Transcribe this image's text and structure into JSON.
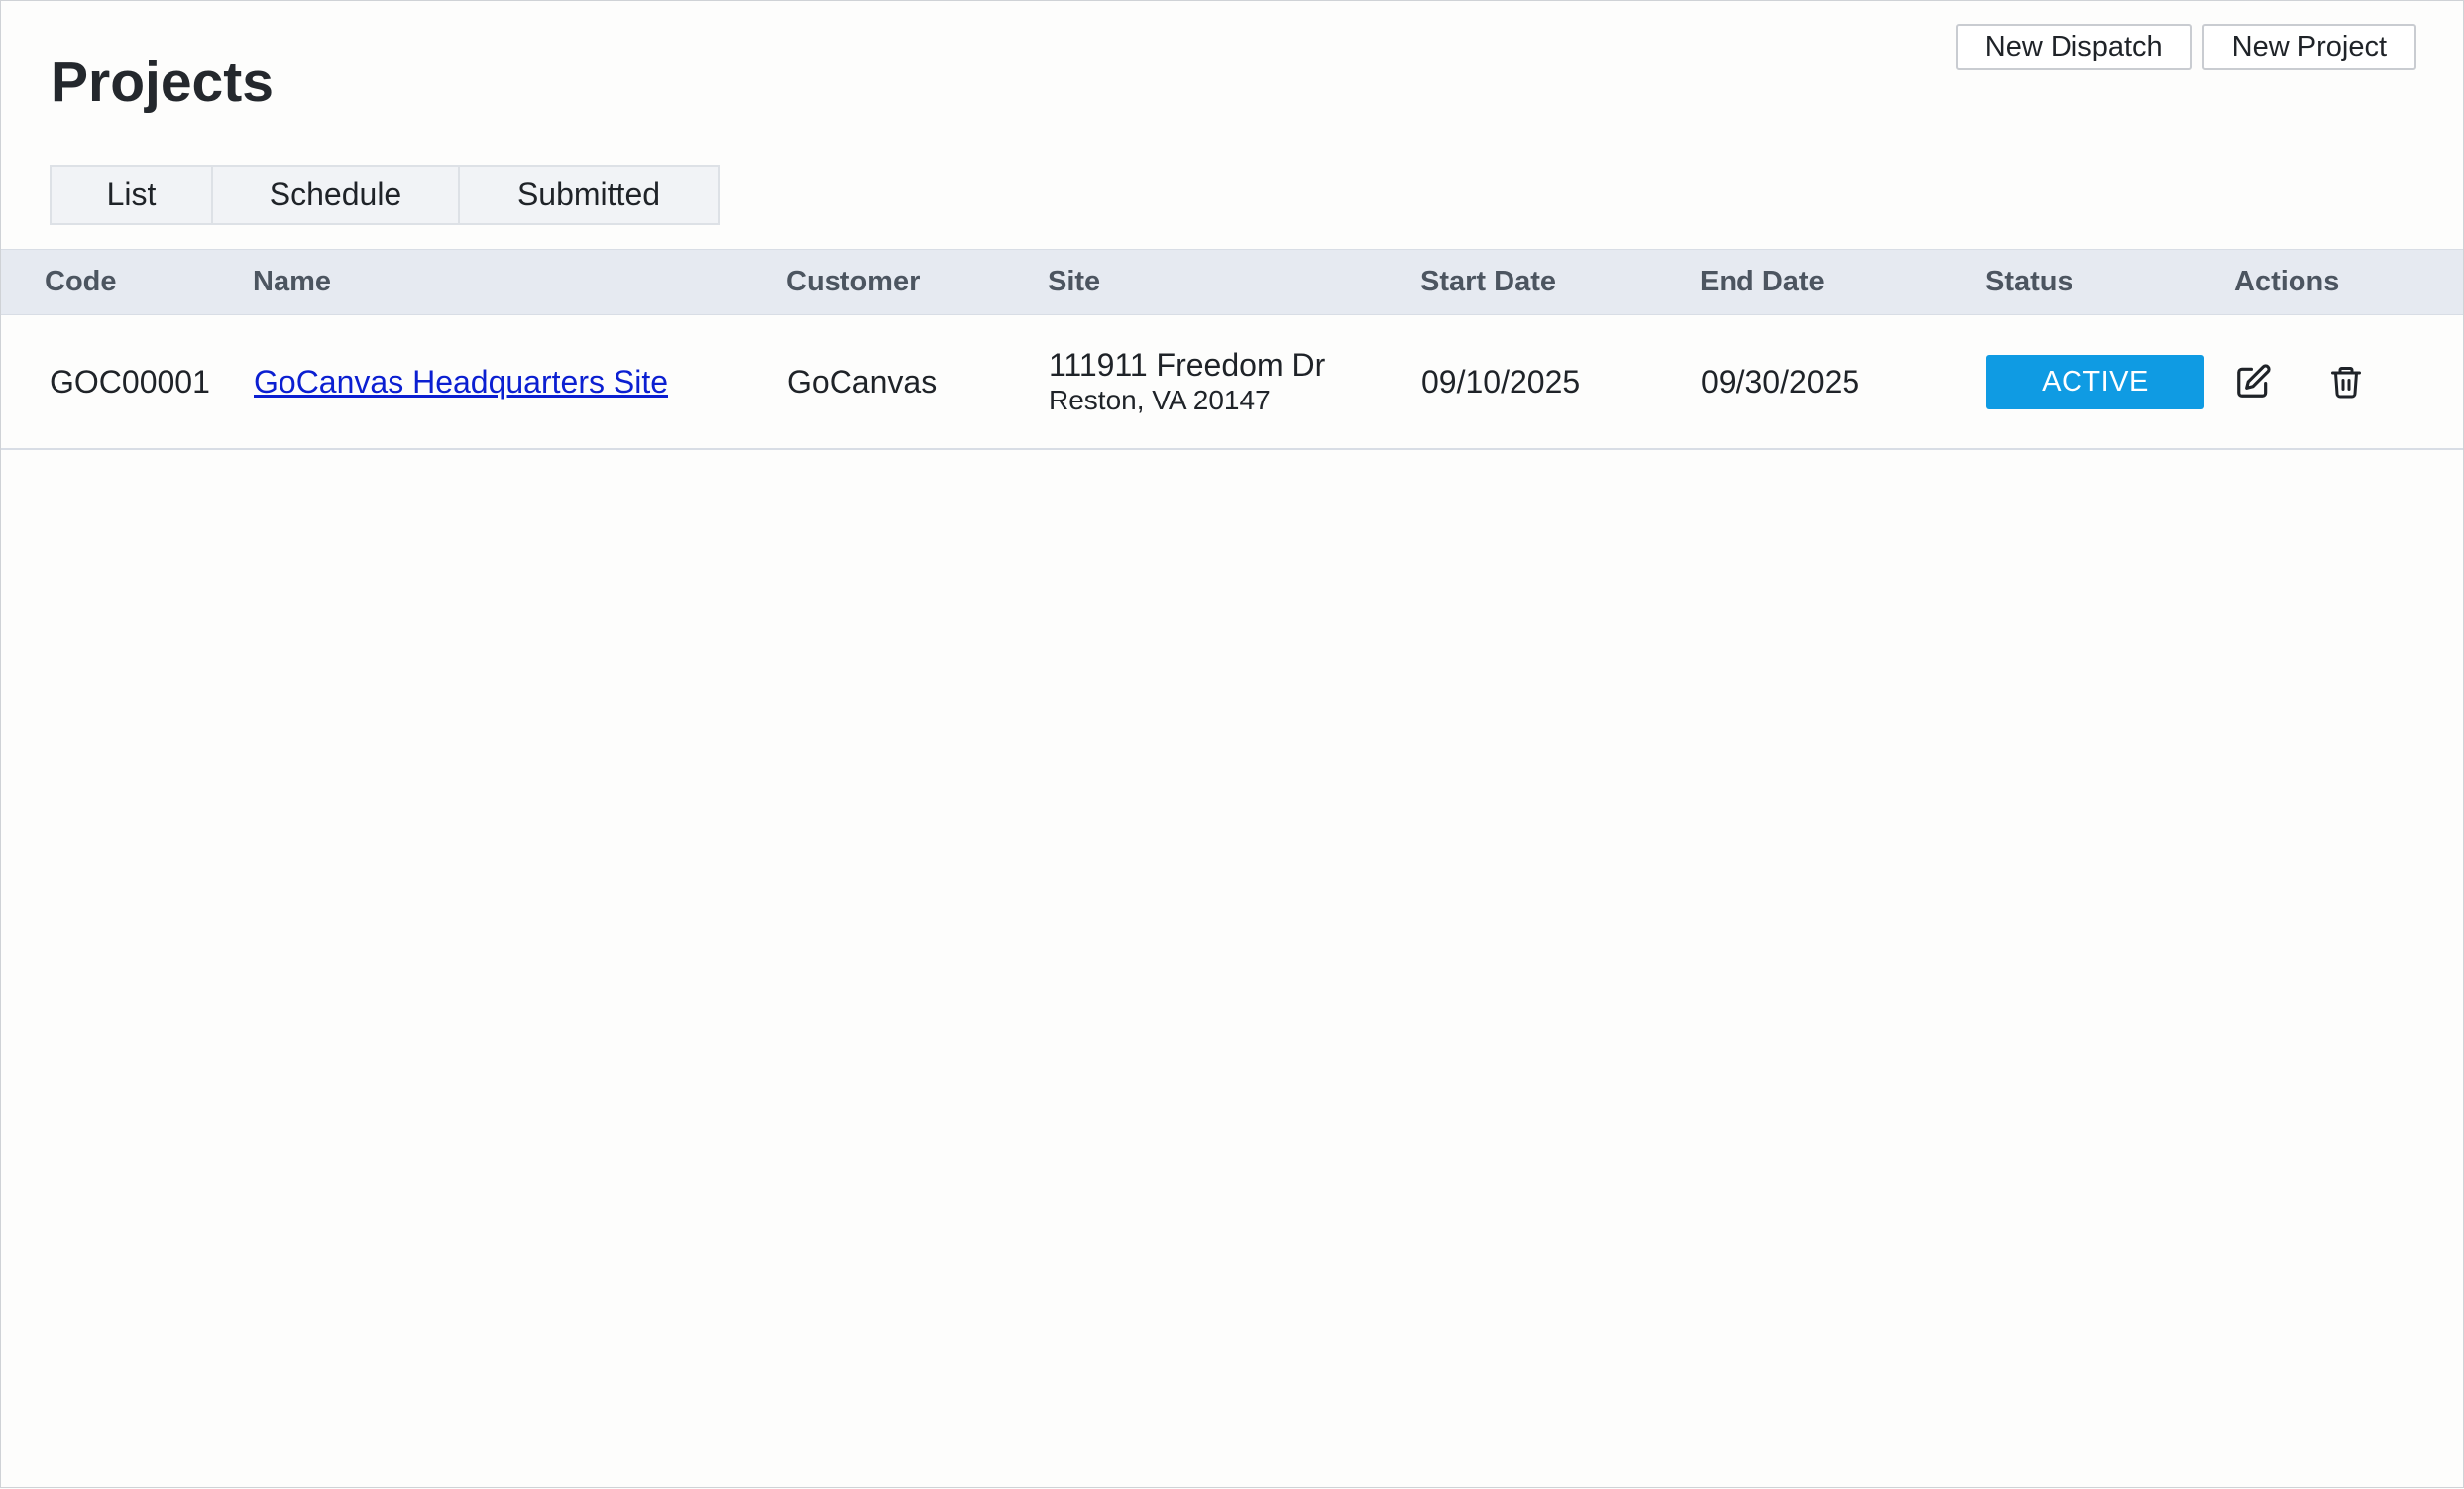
{
  "page": {
    "title": "Projects"
  },
  "header": {
    "new_dispatch_label": "New Dispatch",
    "new_project_label": "New Project"
  },
  "tabs": [
    {
      "label": "List"
    },
    {
      "label": "Schedule"
    },
    {
      "label": "Submitted"
    }
  ],
  "table": {
    "columns": [
      "Code",
      "Name",
      "Customer",
      "Site",
      "Start Date",
      "End Date",
      "Status",
      "Actions"
    ],
    "rows": [
      {
        "code": "GOC00001",
        "name": "GoCanvas Headquarters Site",
        "customer": "GoCanvas",
        "site_line1": "111911 Freedom Dr",
        "site_line2": "Reston, VA 20147",
        "start_date": "09/10/2025",
        "end_date": "09/30/2025",
        "status": "ACTIVE",
        "actions": [
          "edit-icon",
          "trash-icon"
        ]
      }
    ]
  },
  "colors": {
    "status_active": "#0f9be3",
    "link": "#0b1fd1",
    "header_bg": "#e6eaf1"
  }
}
